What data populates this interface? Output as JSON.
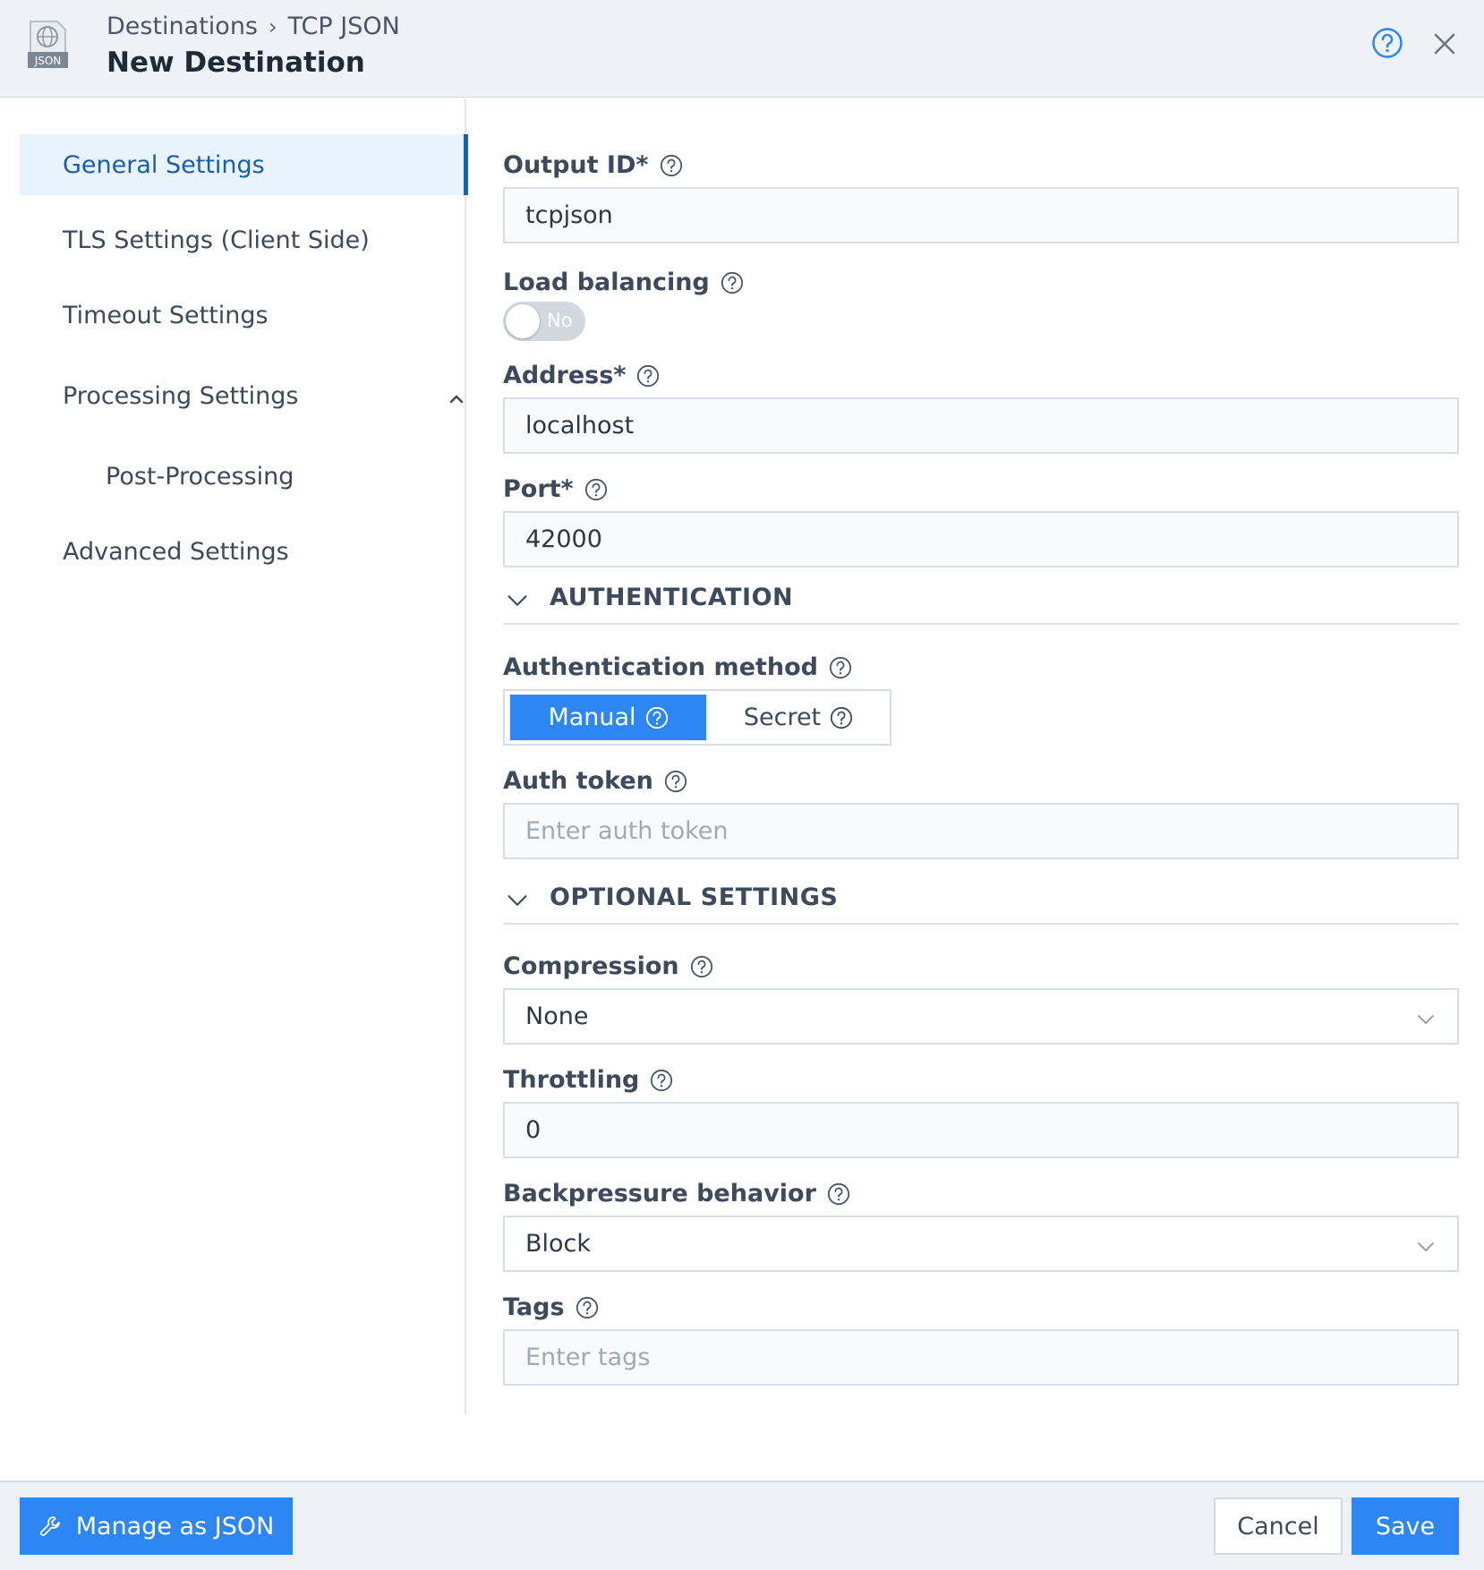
{
  "header": {
    "logo_icon": "tcp-json-logo-icon",
    "logo_text": "JSON",
    "breadcrumb": {
      "parent": "Destinations",
      "separator": "›",
      "current": "TCP JSON"
    },
    "title": "New Destination",
    "help_icon": "help-circle-icon",
    "close_icon": "close-icon"
  },
  "sidebar": {
    "items": [
      {
        "label": "General Settings",
        "active": true
      },
      {
        "label": "TLS Settings (Client Side)"
      },
      {
        "label": "Timeout Settings"
      },
      {
        "label": "Processing Settings",
        "expanded": true
      },
      {
        "label": "Post-Processing",
        "sub": true
      },
      {
        "label": "Advanced Settings"
      }
    ]
  },
  "form": {
    "output_id": {
      "label": "Output ID*",
      "value": "tcpjson"
    },
    "load_balancing": {
      "label": "Load balancing",
      "toggle_text": "No",
      "enabled": false
    },
    "address": {
      "label": "Address*",
      "value": "localhost"
    },
    "port": {
      "label": "Port*",
      "value": "42000"
    },
    "authentication": {
      "section_title": "AUTHENTICATION",
      "method_label": "Authentication method",
      "options": [
        {
          "label": "Manual",
          "selected": true
        },
        {
          "label": "Secret"
        }
      ],
      "auth_token": {
        "label": "Auth token",
        "placeholder": "Enter auth token"
      }
    },
    "optional": {
      "section_title": "OPTIONAL SETTINGS",
      "compression": {
        "label": "Compression",
        "value": "None"
      },
      "throttling": {
        "label": "Throttling",
        "value": "0"
      },
      "backpressure": {
        "label": "Backpressure behavior",
        "value": "Block"
      },
      "tags": {
        "label": "Tags",
        "placeholder": "Enter tags"
      }
    }
  },
  "footer": {
    "manage_json": "Manage as JSON",
    "cancel": "Cancel",
    "save": "Save"
  },
  "colors": {
    "accent": "#2e86f5",
    "active_nav_text": "#1d5ea8",
    "active_nav_bg": "#e8f3fd",
    "header_bg": "#eef2f7"
  }
}
